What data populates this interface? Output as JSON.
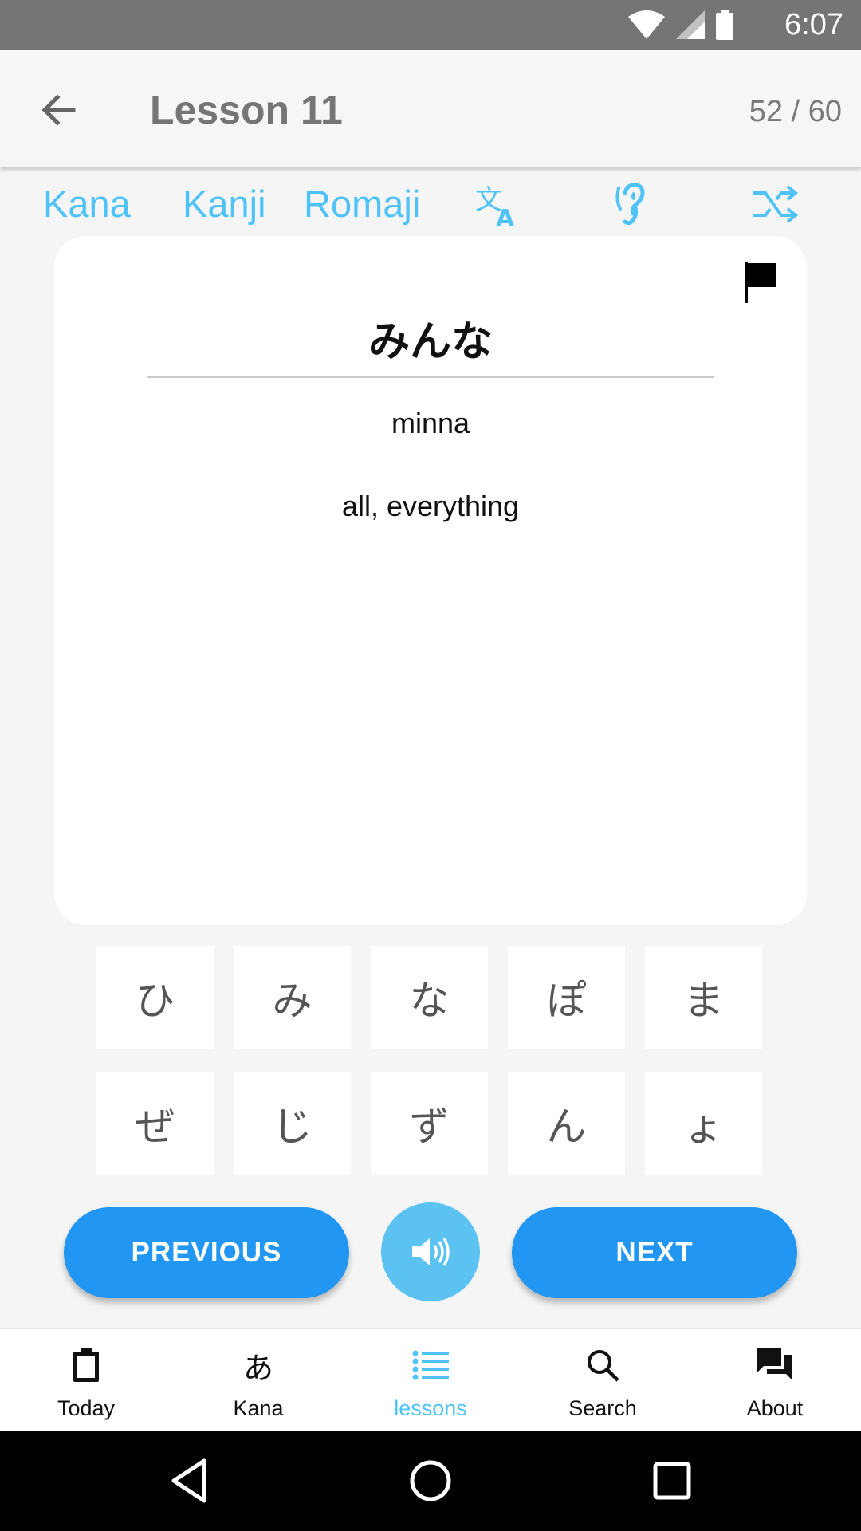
{
  "status_bar": {
    "time": "6:07"
  },
  "app_bar": {
    "title": "Lesson 11",
    "progress": "52 / 60"
  },
  "modes": {
    "kana": "Kana",
    "kanji": "Kanji",
    "romaji": "Romaji"
  },
  "card": {
    "word": "みんな",
    "romaji": "minna",
    "meaning": "all, everything"
  },
  "kana_keys": [
    "ひ",
    "み",
    "な",
    "ぽ",
    "ま",
    "ぜ",
    "じ",
    "ず",
    "ん",
    "ょ"
  ],
  "buttons": {
    "previous": "PREVIOUS",
    "next": "NEXT"
  },
  "nav": [
    {
      "label": "Today",
      "icon": "clipboard-icon"
    },
    {
      "label": "Kana",
      "icon": "あ"
    },
    {
      "label": "lessons",
      "icon": "list-icon"
    },
    {
      "label": "Search",
      "icon": "search-icon"
    },
    {
      "label": "About",
      "icon": "chat-icon"
    }
  ],
  "colors": {
    "accent": "#4fc3f7",
    "primary": "#2196f3",
    "sound": "#5cc2f2"
  }
}
